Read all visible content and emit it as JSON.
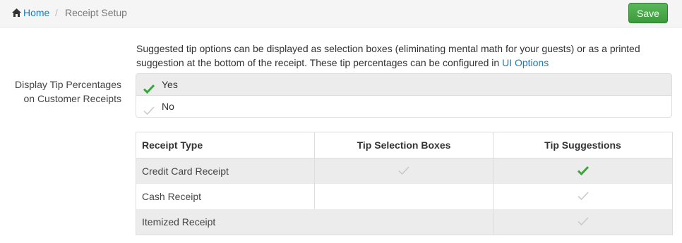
{
  "breadcrumb": {
    "home_label": "Home",
    "separator": "/",
    "current": "Receipt Setup"
  },
  "toolbar": {
    "save_label": "Save"
  },
  "tip_display": {
    "field_label_line1": "Display Tip Percentages",
    "field_label_line2": "on Customer Receipts",
    "help_text": "Suggested tip options can be displayed as selection boxes (eliminating mental math for your guests) or as a printed suggestion at the bottom of the receipt. These tip percentages can be configured in",
    "help_link": "UI Options",
    "options": [
      {
        "label": "Yes",
        "selected": true
      },
      {
        "label": "No",
        "selected": false
      }
    ]
  },
  "receipt_table": {
    "headers": [
      "Receipt Type",
      "Tip Selection Boxes",
      "Tip Suggestions"
    ],
    "rows": [
      {
        "type": "Credit Card Receipt",
        "tip_boxes": false,
        "tip_suggestions": true
      },
      {
        "type": "Cash Receipt",
        "tip_boxes": null,
        "tip_suggestions": false
      },
      {
        "type": "Itemized Receipt",
        "tip_boxes": null,
        "tip_suggestions": false
      }
    ]
  },
  "colors": {
    "link": "#1a7bb9",
    "save_button": "#4cae4c",
    "check_on": "#3aa53a",
    "check_off": "#c8c8c8",
    "row_shade": "#ececec"
  },
  "icons": {
    "home": "home-icon",
    "check_on": "check-icon",
    "check_off": "check-outline-icon"
  }
}
